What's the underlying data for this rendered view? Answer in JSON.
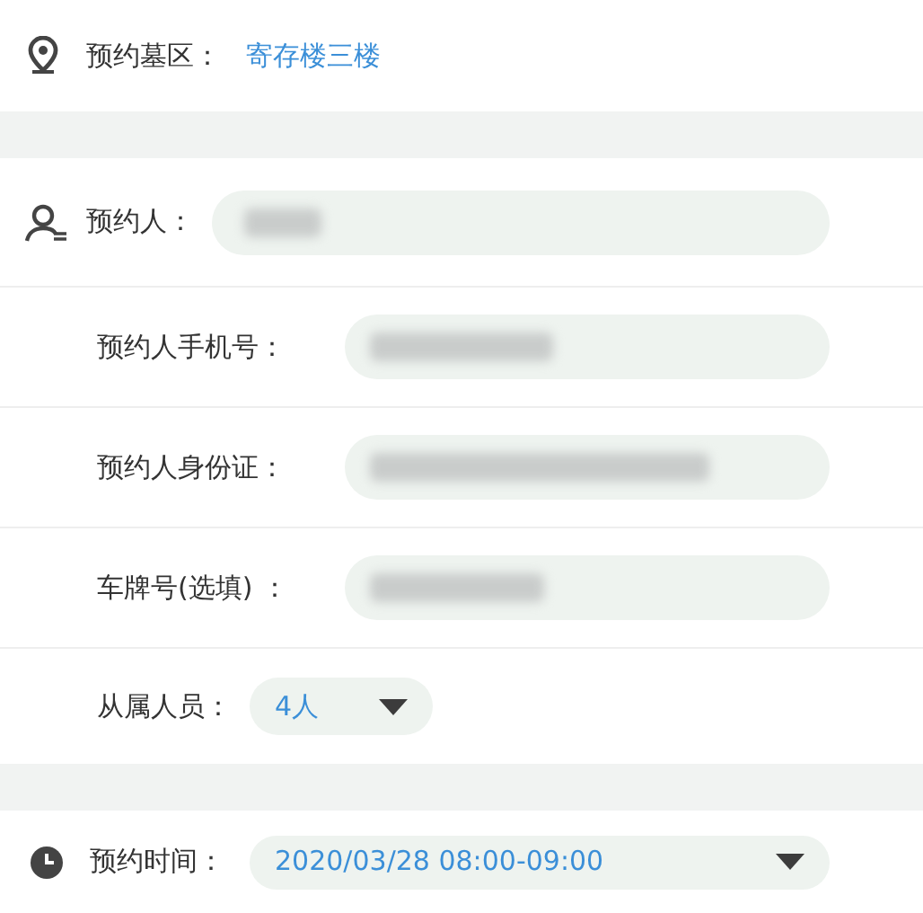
{
  "area": {
    "label": "预约墓区：",
    "value": "寄存楼三楼"
  },
  "person": {
    "label": "预约人：",
    "blurred": true
  },
  "fields": [
    {
      "label": "预约人手机号：",
      "blurred": true
    },
    {
      "label": "预约人身份证：",
      "blurred": true
    },
    {
      "label": "车牌号(选填) ：",
      "blurred": true
    }
  ],
  "members": {
    "label": "从属人员：",
    "value": "4人"
  },
  "time": {
    "label": "预约时间：",
    "value": "2020/03/28 08:00-09:00"
  }
}
